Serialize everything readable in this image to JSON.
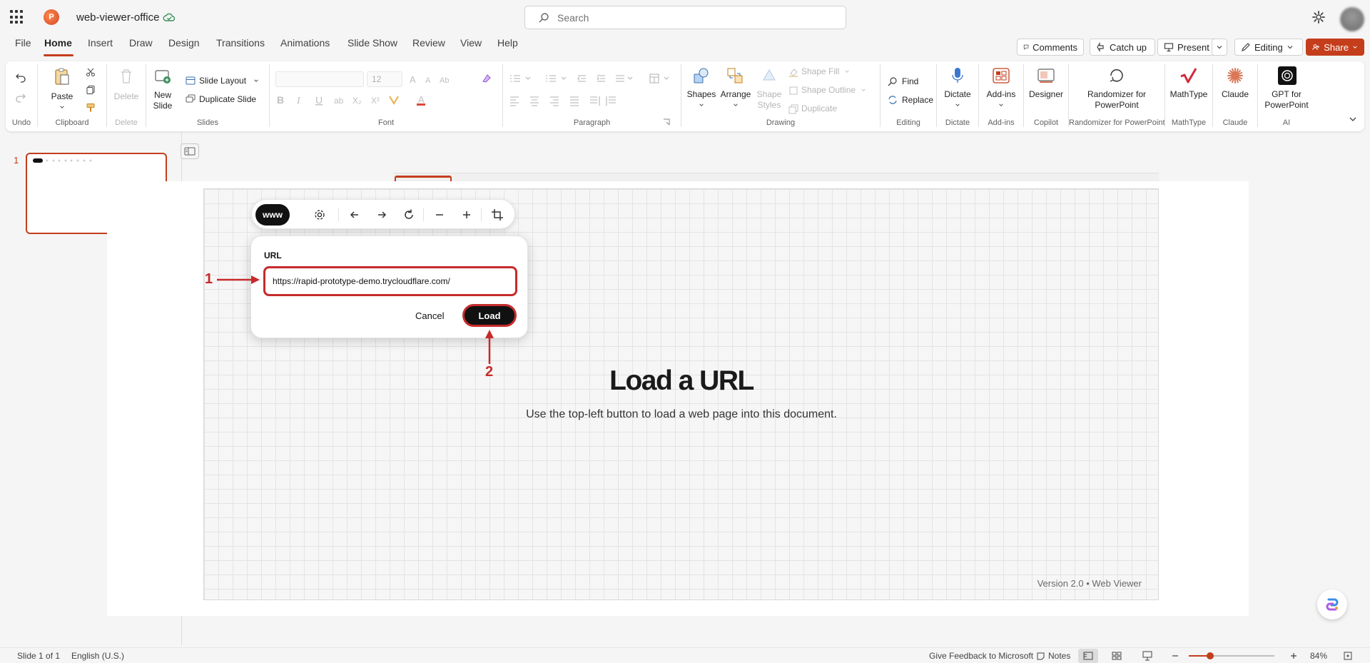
{
  "app": {
    "doc_name": "web-viewer-office",
    "search_placeholder": "Search",
    "app_letter": "P"
  },
  "tabs": [
    "File",
    "Home",
    "Insert",
    "Draw",
    "Design",
    "Transitions",
    "Animations",
    "Slide Show",
    "Review",
    "View",
    "Help"
  ],
  "active_tab": "Home",
  "right_buttons": {
    "comments": "Comments",
    "catch_up": "Catch up",
    "present": "Present",
    "editing": "Editing",
    "share": "Share"
  },
  "ribbon": {
    "undo_label": "Undo",
    "clipboard": {
      "paste": "Paste",
      "label": "Clipboard"
    },
    "delete": {
      "button": "Delete",
      "label": "Delete"
    },
    "slides": {
      "new_slide_1": "New",
      "new_slide_2": "Slide",
      "layout": "Slide Layout",
      "duplicate": "Duplicate Slide",
      "label": "Slides"
    },
    "font": {
      "size": "12",
      "label": "Font"
    },
    "paragraph": {
      "label": "Paragraph"
    },
    "drawing": {
      "shapes": "Shapes",
      "arrange": "Arrange",
      "shape_styles_1": "Shape",
      "shape_styles_2": "Styles",
      "shape_fill": "Shape Fill",
      "shape_outline": "Shape Outline",
      "duplicate": "Duplicate",
      "label": "Drawing"
    },
    "editing": {
      "find": "Find",
      "replace": "Replace",
      "label": "Editing"
    },
    "dictate": {
      "button": "Dictate",
      "label": "Dictate"
    },
    "addins": {
      "button": "Add-ins",
      "label": "Add-ins"
    },
    "copilot": {
      "button": "Designer",
      "label": "Copilot"
    },
    "randomizer": {
      "button_1": "Randomizer for",
      "button_2": "PowerPoint",
      "label": "Randomizer for PowerPoint"
    },
    "mathtype": {
      "button": "MathType",
      "label": "MathType"
    },
    "claude": {
      "button": "Claude",
      "label": "Claude"
    },
    "ai": {
      "button_1": "GPT for",
      "button_2": "PowerPoint",
      "label": "AI"
    }
  },
  "slides_pane": {
    "number": "1"
  },
  "web_viewer": {
    "www_label": "www",
    "url_label": "URL",
    "url_value": "https://rapid-prototype-demo.trycloudflare.com/",
    "cancel": "Cancel",
    "load": "Load",
    "title": "Load a URL",
    "subtitle": "Use the top-left button to load a web page into this document.",
    "version": "Version 2.0 • Web Viewer"
  },
  "annotations": {
    "step1": "1",
    "step2": "2",
    "color": "#c62b2b"
  },
  "status": {
    "slide": "Slide 1 of 1",
    "language": "English (U.S.)",
    "feedback": "Give Feedback to Microsoft",
    "notes": "Notes",
    "zoom": "84%"
  },
  "colors": {
    "accent": "#c43e1c"
  }
}
